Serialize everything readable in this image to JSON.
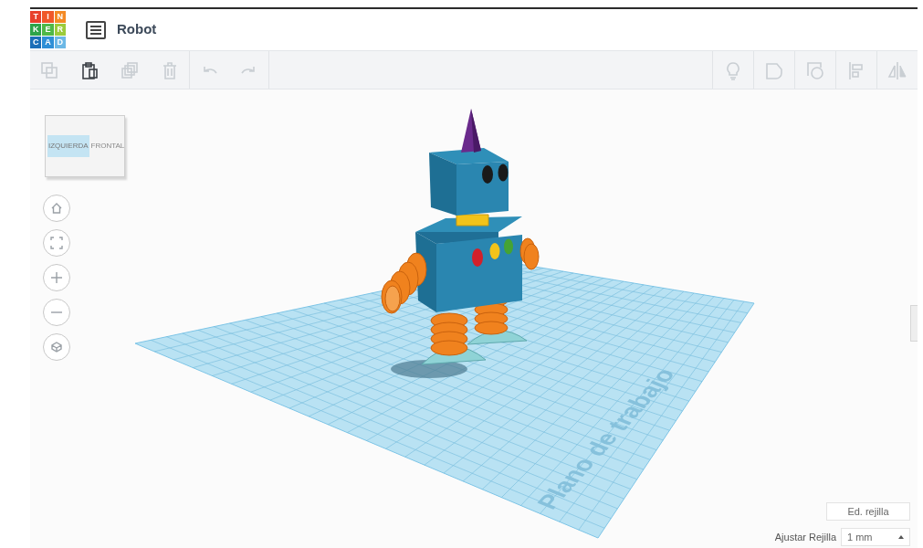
{
  "logo": {
    "tiles": [
      {
        "letter": "T",
        "color": "#e8412c"
      },
      {
        "letter": "I",
        "color": "#f0582a"
      },
      {
        "letter": "N",
        "color": "#f48a25"
      },
      {
        "letter": "K",
        "color": "#2da44a"
      },
      {
        "letter": "E",
        "color": "#4fb848"
      },
      {
        "letter": "R",
        "color": "#9ccb3b"
      },
      {
        "letter": "C",
        "color": "#1c6fb8"
      },
      {
        "letter": "A",
        "color": "#2e8fd6"
      },
      {
        "letter": "D",
        "color": "#6cb8e6"
      }
    ]
  },
  "header": {
    "title": "Robot"
  },
  "toolbar": {
    "left_groups": [
      [
        {
          "kind": "copy",
          "disabled": true
        },
        {
          "kind": "paste",
          "disabled": false
        },
        {
          "kind": "duplicate",
          "disabled": true
        },
        {
          "kind": "delete",
          "disabled": true
        }
      ],
      [
        {
          "kind": "undo",
          "disabled": true
        },
        {
          "kind": "redo",
          "disabled": true
        }
      ]
    ],
    "right_items": [
      {
        "kind": "bulb",
        "disabled": true
      },
      {
        "kind": "shape",
        "disabled": true
      },
      {
        "kind": "hole",
        "disabled": true
      },
      {
        "kind": "align",
        "disabled": true
      },
      {
        "kind": "mirror",
        "disabled": true
      }
    ]
  },
  "view_cube": {
    "left_face": "IZQUIERDA",
    "right_face": "FRONTAL"
  },
  "nav_controls": [
    {
      "kind": "home"
    },
    {
      "kind": "fit"
    },
    {
      "kind": "zoom-in"
    },
    {
      "kind": "zoom-out"
    },
    {
      "kind": "ortho"
    }
  ],
  "workplane": {
    "label": "Plano de trabajo"
  },
  "grid": {
    "edit_button": "Ed. rejilla",
    "snap_label": "Ajustar Rejilla",
    "snap_value": "1 mm"
  }
}
